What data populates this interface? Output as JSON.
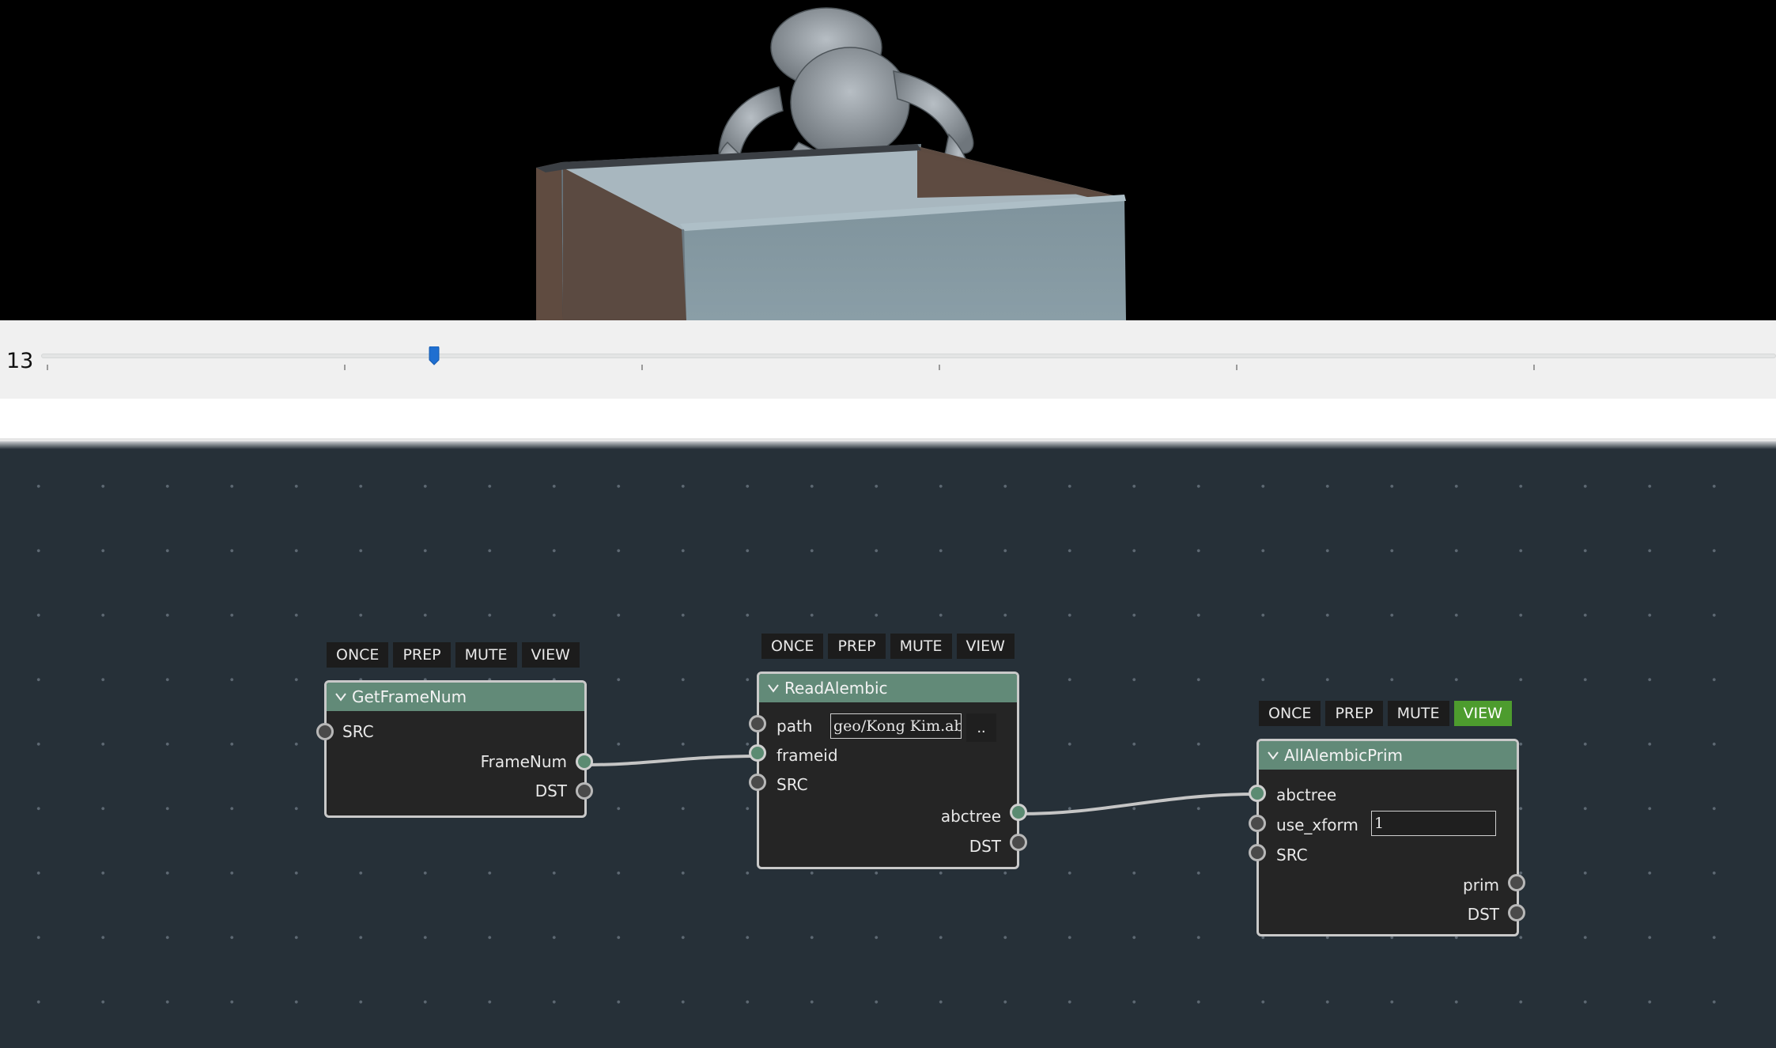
{
  "timeline": {
    "frame": "13",
    "position_fraction": 0.218
  },
  "nodes": {
    "getframenum": {
      "title": "GetFrameNum",
      "buttons": [
        "ONCE",
        "PREP",
        "MUTE",
        "VIEW"
      ],
      "inputs": [
        "SRC"
      ],
      "outputs": [
        "FrameNum",
        "DST"
      ]
    },
    "readalembic": {
      "title": "ReadAlembic",
      "buttons": [
        "ONCE",
        "PREP",
        "MUTE",
        "VIEW"
      ],
      "inputs": [
        "path",
        "frameid",
        "SRC"
      ],
      "path_value": "geo/Kong Kim.abc",
      "browse_label": "..",
      "outputs": [
        "abctree",
        "DST"
      ]
    },
    "allalembicprim": {
      "title": "AllAlembicPrim",
      "buttons": [
        "ONCE",
        "PREP",
        "MUTE",
        "VIEW"
      ],
      "active_button": "VIEW",
      "inputs": [
        "abctree",
        "use_xform",
        "SRC"
      ],
      "use_xform_value": "1",
      "outputs": [
        "prim",
        "DST"
      ]
    }
  },
  "colors": {
    "node_header": "#628a78",
    "editor_bg": "#263038",
    "view_active": "#4d9c2e",
    "slider_handle": "#1f6fd1"
  }
}
